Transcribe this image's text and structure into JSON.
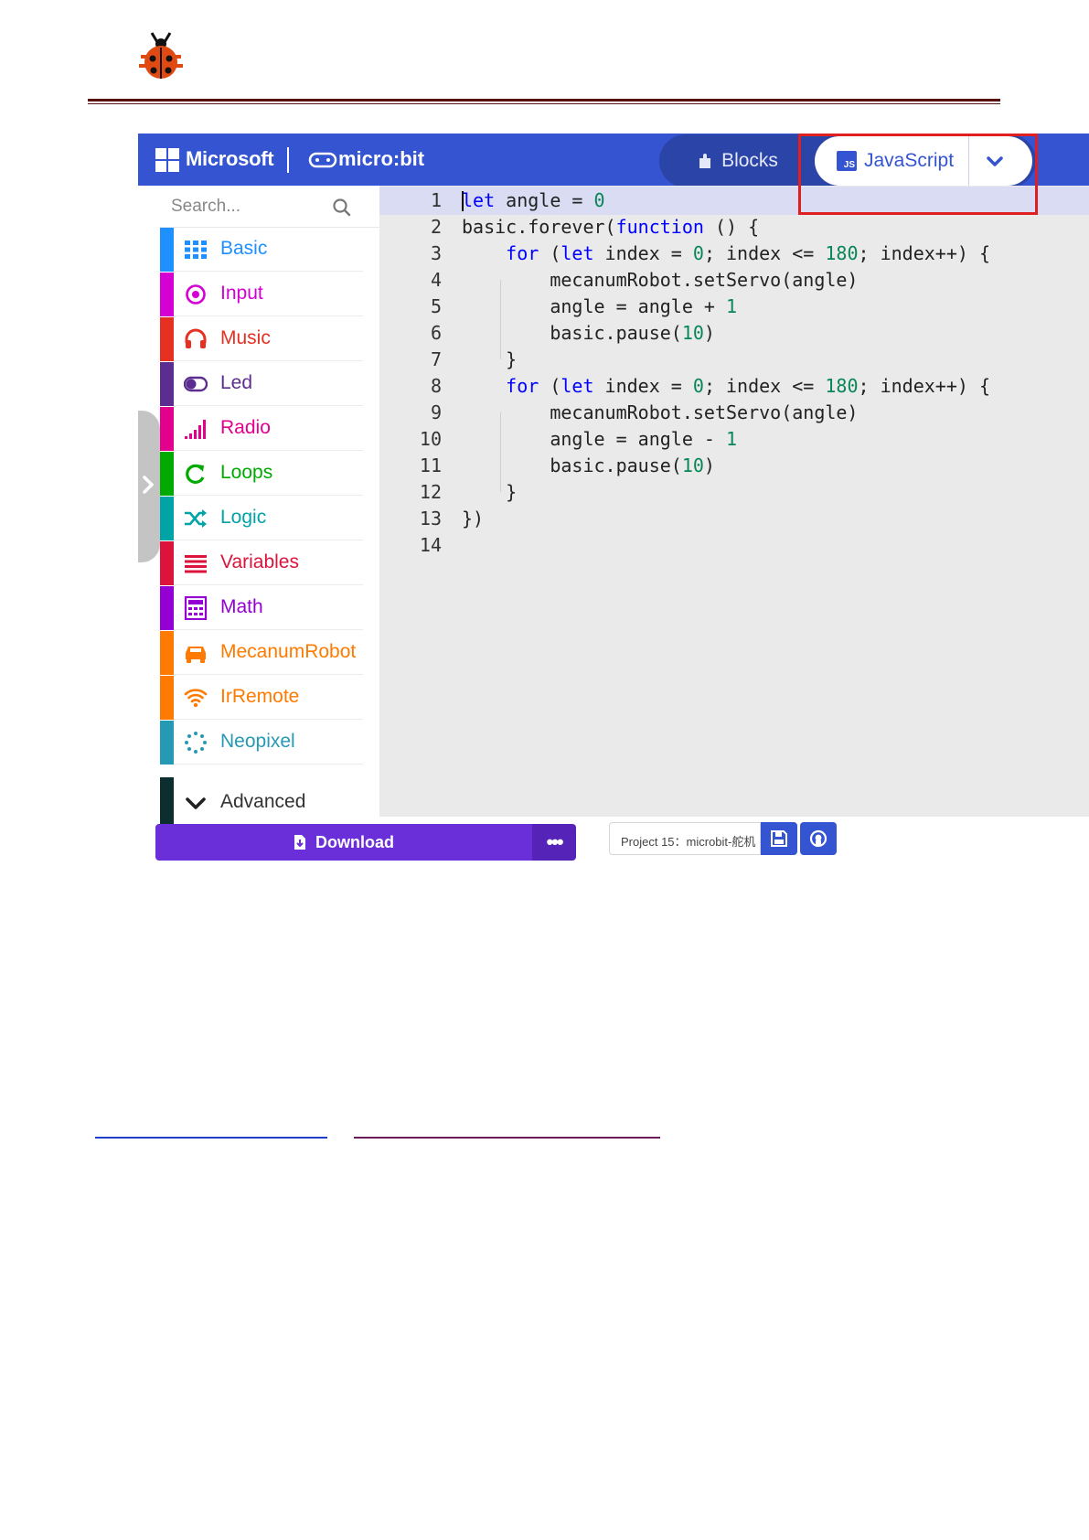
{
  "header": {
    "brand": "Microsoft",
    "product": "micro:bit",
    "tabs": [
      {
        "label": "Blocks",
        "active": false
      },
      {
        "label": "JavaScript",
        "active": true
      }
    ],
    "js_badge": "JS"
  },
  "toolbox": {
    "search_placeholder": "Search...",
    "categories": [
      {
        "label": "Basic",
        "color": "#1e90ff",
        "icon": "grid-icon"
      },
      {
        "label": "Input",
        "color": "#d400d4",
        "icon": "target-icon"
      },
      {
        "label": "Music",
        "color": "#e63022",
        "icon": "headphones-icon"
      },
      {
        "label": "Led",
        "color": "#5c2d91",
        "icon": "toggle-icon"
      },
      {
        "label": "Radio",
        "color": "#e3008c",
        "icon": "signal-bars-icon"
      },
      {
        "label": "Loops",
        "color": "#00aa00",
        "icon": "refresh-icon"
      },
      {
        "label": "Logic",
        "color": "#00a4a6",
        "icon": "shuffle-icon"
      },
      {
        "label": "Variables",
        "color": "#dc143c",
        "icon": "list-icon"
      },
      {
        "label": "Math",
        "color": "#9400d3",
        "icon": "calculator-icon"
      },
      {
        "label": "MecanumRobot",
        "color": "#ff7a00",
        "icon": "car-icon"
      },
      {
        "label": "IrRemote",
        "color": "#ff7a00",
        "icon": "wifi-icon"
      },
      {
        "label": "Neopixel",
        "color": "#2699b4",
        "icon": "dots-circle-icon"
      },
      {
        "label": "Advanced",
        "color": "#0d2e2e",
        "icon": "chevron-down-icon"
      }
    ]
  },
  "editor": {
    "lines": [
      "let angle = 0",
      "basic.forever(function () {",
      "    for (let index = 0; index <= 180; index++) {",
      "        mecanumRobot.setServo(angle)",
      "        angle = angle + 1",
      "        basic.pause(10)",
      "    }",
      "    for (let index = 0; index <= 180; index++) {",
      "        mecanumRobot.setServo(angle)",
      "        angle = angle - 1",
      "        basic.pause(10)",
      "    }",
      "})",
      ""
    ],
    "active_line": 1
  },
  "bottombar": {
    "download_label": "Download",
    "more_label": "•••",
    "project_name": "Project 15：microbit-舵机"
  },
  "colors": {
    "topbar": "#3454d1",
    "download": "#6a2fd8",
    "highlight": "#e02020"
  }
}
